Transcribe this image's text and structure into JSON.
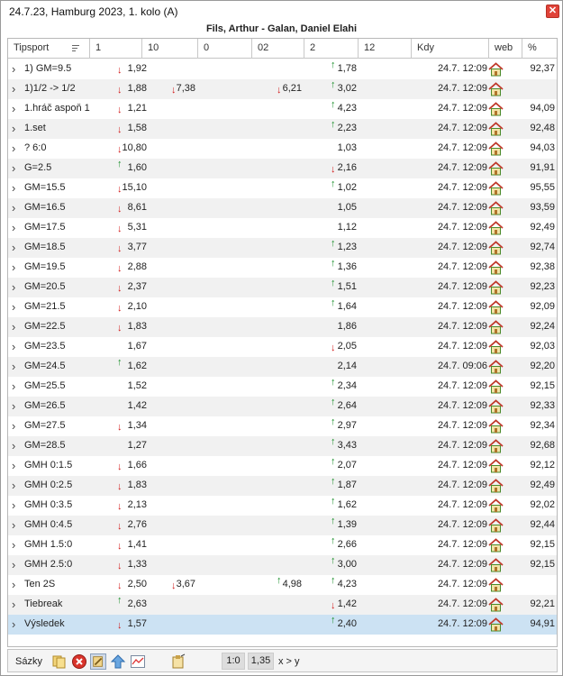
{
  "window": {
    "title": "24.7.23, Hamburg 2023, 1. kolo (A)",
    "close_glyph": "✕"
  },
  "match_title": "Fils, Arthur - Galan, Daniel Elahi",
  "columns": [
    "Tipsport",
    "1",
    "10",
    "0",
    "02",
    "2",
    "12",
    "Kdy",
    "web",
    "%"
  ],
  "rows": [
    {
      "name": "1) GM=9.5",
      "o1": "1,92",
      "a1": "dn",
      "o2": "1,78",
      "a2": "up",
      "kdy": "24.7. 12:09",
      "pct": "92,37"
    },
    {
      "name": "1)1/2 -> 1/2",
      "o1": "1,88",
      "a1": "dn",
      "o10": "7,38",
      "a10": "dn",
      "o02": "6,21",
      "a02": "dn",
      "o2": "3,02",
      "a2": "up",
      "kdy": "24.7. 12:09",
      "pct": ""
    },
    {
      "name": "1.hráč aspoň 1",
      "o1": "1,21",
      "a1": "dn",
      "o2": "4,23",
      "a2": "up",
      "kdy": "24.7. 12:09",
      "pct": "94,09"
    },
    {
      "name": "1.set",
      "o1": "1,58",
      "a1": "dn",
      "o2": "2,23",
      "a2": "up",
      "kdy": "24.7. 12:09",
      "pct": "92,48"
    },
    {
      "name": "? 6:0",
      "o1": "10,80",
      "a1": "dn",
      "o2": "1,03",
      "kdy": "24.7. 12:09",
      "pct": "94,03"
    },
    {
      "name": "G=2.5",
      "o1": "1,60",
      "a1": "up",
      "o2": "2,16",
      "a2": "dn",
      "kdy": "24.7. 12:09",
      "pct": "91,91"
    },
    {
      "name": "GM=15.5",
      "o1": "15,10",
      "a1": "dn",
      "o2": "1,02",
      "a2": "up",
      "kdy": "24.7. 12:09",
      "pct": "95,55"
    },
    {
      "name": "GM=16.5",
      "o1": "8,61",
      "a1": "dn",
      "o2": "1,05",
      "kdy": "24.7. 12:09",
      "pct": "93,59"
    },
    {
      "name": "GM=17.5",
      "o1": "5,31",
      "a1": "dn",
      "o2": "1,12",
      "kdy": "24.7. 12:09",
      "pct": "92,49"
    },
    {
      "name": "GM=18.5",
      "o1": "3,77",
      "a1": "dn",
      "o2": "1,23",
      "a2": "up",
      "kdy": "24.7. 12:09",
      "pct": "92,74"
    },
    {
      "name": "GM=19.5",
      "o1": "2,88",
      "a1": "dn",
      "o2": "1,36",
      "a2": "up",
      "kdy": "24.7. 12:09",
      "pct": "92,38"
    },
    {
      "name": "GM=20.5",
      "o1": "2,37",
      "a1": "dn",
      "o2": "1,51",
      "a2": "up",
      "kdy": "24.7. 12:09",
      "pct": "92,23"
    },
    {
      "name": "GM=21.5",
      "o1": "2,10",
      "a1": "dn",
      "o2": "1,64",
      "a2": "up",
      "kdy": "24.7. 12:09",
      "pct": "92,09"
    },
    {
      "name": "GM=22.5",
      "o1": "1,83",
      "a1": "dn",
      "o2": "1,86",
      "kdy": "24.7. 12:09",
      "pct": "92,24"
    },
    {
      "name": "GM=23.5",
      "o1": "1,67",
      "o2": "2,05",
      "a2": "dn",
      "kdy": "24.7. 12:09",
      "pct": "92,03"
    },
    {
      "name": "GM=24.5",
      "o1": "1,62",
      "a1": "up",
      "o2": "2,14",
      "kdy": "24.7. 09:06",
      "pct": "92,20"
    },
    {
      "name": "GM=25.5",
      "o1": "1,52",
      "o2": "2,34",
      "a2": "up",
      "kdy": "24.7. 12:09",
      "pct": "92,15"
    },
    {
      "name": "GM=26.5",
      "o1": "1,42",
      "o2": "2,64",
      "a2": "up",
      "kdy": "24.7. 12:09",
      "pct": "92,33"
    },
    {
      "name": "GM=27.5",
      "o1": "1,34",
      "a1": "dn",
      "o2": "2,97",
      "a2": "up",
      "kdy": "24.7. 12:09",
      "pct": "92,34"
    },
    {
      "name": "GM=28.5",
      "o1": "1,27",
      "o2": "3,43",
      "a2": "up",
      "kdy": "24.7. 12:09",
      "pct": "92,68"
    },
    {
      "name": "GMH 0:1.5",
      "o1": "1,66",
      "a1": "dn",
      "o2": "2,07",
      "a2": "up",
      "kdy": "24.7. 12:09",
      "pct": "92,12"
    },
    {
      "name": "GMH 0:2.5",
      "o1": "1,83",
      "a1": "dn",
      "o2": "1,87",
      "a2": "up",
      "kdy": "24.7. 12:09",
      "pct": "92,49"
    },
    {
      "name": "GMH 0:3.5",
      "o1": "2,13",
      "a1": "dn",
      "o2": "1,62",
      "a2": "up",
      "kdy": "24.7. 12:09",
      "pct": "92,02"
    },
    {
      "name": "GMH 0:4.5",
      "o1": "2,76",
      "a1": "dn",
      "o2": "1,39",
      "a2": "up",
      "kdy": "24.7. 12:09",
      "pct": "92,44"
    },
    {
      "name": "GMH 1.5:0",
      "o1": "1,41",
      "a1": "dn",
      "o2": "2,66",
      "a2": "up",
      "kdy": "24.7. 12:09",
      "pct": "92,15"
    },
    {
      "name": "GMH 2.5:0",
      "o1": "1,33",
      "a1": "dn",
      "o2": "3,00",
      "a2": "up",
      "kdy": "24.7. 12:09",
      "pct": "92,15"
    },
    {
      "name": "Ten 2S",
      "o1": "2,50",
      "a1": "dn",
      "o10": "3,67",
      "a10": "dn",
      "o02": "4,98",
      "a02": "up",
      "o2": "4,23",
      "a2": "up",
      "kdy": "24.7. 12:09",
      "pct": ""
    },
    {
      "name": "Tiebreak",
      "o1": "2,63",
      "a1": "up",
      "o2": "1,42",
      "a2": "dn",
      "kdy": "24.7. 12:09",
      "pct": "92,21"
    },
    {
      "name": "Výsledek",
      "o1": "1,57",
      "a1": "dn",
      "o2": "2,40",
      "a2": "up",
      "kdy": "24.7. 12:09",
      "pct": "94,91",
      "selected": true
    }
  ],
  "footer": {
    "label": "Sázky",
    "score": "1:0",
    "odds": "1,35",
    "xy": "x > y"
  },
  "icons": {
    "expand": "chevron-right-icon",
    "web": "home-icon",
    "up": "arrow-up-icon",
    "down": "arrow-down-icon"
  },
  "colors": {
    "up": "#1a8f2a",
    "down": "#d21a1a",
    "selected_row": "#cce2f3",
    "alt_row": "#f1f1f1",
    "close": "#e04339"
  }
}
